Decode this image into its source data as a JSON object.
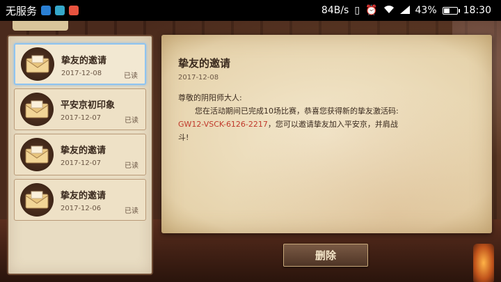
{
  "status_bar": {
    "carrier": "无服务",
    "net_speed": "84B/s",
    "battery_percent": "43%",
    "time": "18:30",
    "app_icon_colors": [
      "#2a7fd4",
      "#35a7c9",
      "#e8533f"
    ]
  },
  "mail_list": [
    {
      "title": "挚友的邀请",
      "date": "2017-12-08",
      "status": "已读",
      "selected": true
    },
    {
      "title": "平安京初印象",
      "date": "2017-12-07",
      "status": "已读",
      "selected": false
    },
    {
      "title": "挚友的邀请",
      "date": "2017-12-07",
      "status": "已读",
      "selected": false
    },
    {
      "title": "挚友的邀请",
      "date": "2017-12-06",
      "status": "已读",
      "selected": false
    }
  ],
  "letter": {
    "title": "挚友的邀请",
    "date": "2017-12-08",
    "greeting": "尊敬的阴阳师大人:",
    "line1": "您在活动期间已完成10场比赛，恭喜您获得新的挚友激活码:",
    "code": "GW12-VSCK-6126-2217",
    "line2": "，您可以邀请挚友加入平安京，并肩战",
    "line3": "斗!"
  },
  "actions": {
    "delete_label": "删除"
  },
  "colors": {
    "code_red": "#c0392b",
    "selection_blue": "#8fc4f0"
  }
}
